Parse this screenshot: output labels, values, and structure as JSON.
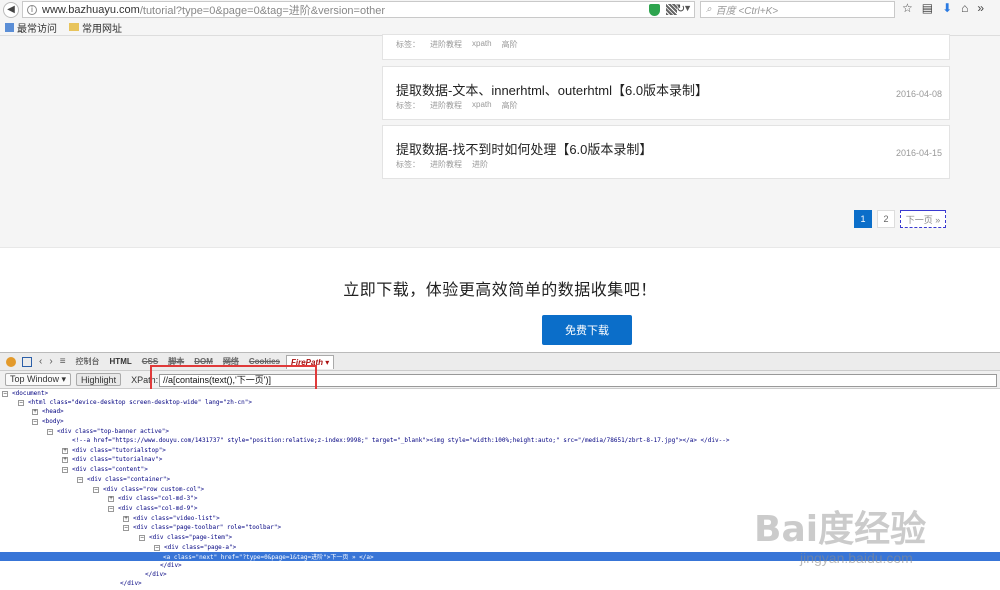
{
  "browser": {
    "url_host": "www.bazhuayu.com",
    "url_path": "/tutorial?type=0&page=0&tag=进阶&version=other",
    "search_placeholder": "百度 <Ctrl+K>",
    "bookmarks": [
      "最常访问",
      "常用网址"
    ]
  },
  "articles": [
    {
      "title": "",
      "tag_label": "标签：",
      "tags": [
        "进阶教程",
        "xpath",
        "高阶"
      ],
      "date": ""
    },
    {
      "title": "提取数据-文本、innerhtml、outerhtml【6.0版本录制】",
      "tag_label": "标签：",
      "tags": [
        "进阶教程",
        "xpath",
        "高阶"
      ],
      "date": "2016-04-08"
    },
    {
      "title": "提取数据-找不到时如何处理【6.0版本录制】",
      "tag_label": "标签：",
      "tags": [
        "进阶教程",
        "进阶"
      ],
      "date": "2016-04-15"
    }
  ],
  "pagination": {
    "pages": [
      "1",
      "2"
    ],
    "next": "下一页 »"
  },
  "cta": {
    "text": "立即下载，体验更高效简单的数据收集吧！",
    "button": "免费下载"
  },
  "firebug": {
    "tabs": [
      "控制台",
      "HTML",
      "CSS",
      "脚本",
      "DOM",
      "网络",
      "Cookies",
      "FirePath ▾"
    ],
    "top_window": "Top Window ▾",
    "highlight": "Highlight",
    "xpath_label": "XPath:",
    "xpath_value": "//a[contains(text(),'下一页')]",
    "tree": [
      "<document>",
      "<html  class=\"device-desktop screen-desktop-wide\"  lang=\"zh-cn\">",
      "<head>",
      "<body>",
      "<div  class=\"top-banner active\">",
      "<!--a href=\"https://www.douyu.com/1431737\" style=\"position:relative;z-index:9998;\" target=\"_blank\"><img style=\"width:100%;height:auto;\" src=\"/media/78651/zbrt-8-17.jpg\"></a> </div-->",
      "<div  class=\"tutorialstop\">",
      "<div  class=\"tutorialnav\">",
      "<div  class=\"content\">",
      "<div  class=\"container\">",
      "<div  class=\"row custom-col\">",
      "<div  class=\"col-md-3\">",
      "<div  class=\"col-md-9\">",
      "<div  class=\"video-list\">",
      "<div  class=\"page-toolbar\"  role=\"toolbar\">",
      "<div  class=\"page-item\">",
      "<div  class=\"page-a\">",
      "<a  class=\"next\"  href=\"?type=0&page=1&tag=进阶\">下一页  » </a>",
      "</div>",
      "</div>",
      "</div>"
    ]
  },
  "watermark": {
    "text": "Bai度经验",
    "url": "jingyan.baidu.com"
  }
}
